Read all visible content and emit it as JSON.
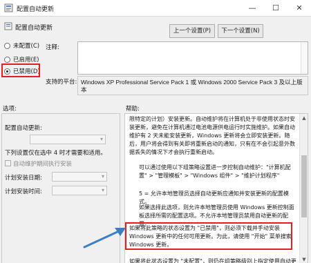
{
  "window": {
    "title": "配置自动更新",
    "buttons": [
      "—",
      "☐",
      "✕"
    ]
  },
  "header": {
    "policy_name": "配置自动更新",
    "prev_button": "上一个设置(P)",
    "next_button": "下一个设置(N)"
  },
  "state": {
    "options": [
      {
        "label": "未配置(C)",
        "checked": false
      },
      {
        "label": "已启用(E)",
        "checked": false
      },
      {
        "label": "已禁用(D)",
        "checked": true
      }
    ]
  },
  "comment": {
    "label": "注释:"
  },
  "platform": {
    "label": "支持的平台:",
    "value": "Windows XP Professional Service Pack 1 或 Windows 2000 Service Pack 3 及以上版本"
  },
  "sections": {
    "options": "选项:",
    "help": "帮助:"
  },
  "options_panel": {
    "configure_label": "配置自动更新:",
    "note": "下列设置仅在选中 4 时才需要和适用。",
    "maintenance_label": "自动维护期间执行安装",
    "schedule_day_label": "计划安装日期:",
    "schedule_time_label": "计划安装时间:"
  },
  "help": {
    "paragraphs": [
      "限特定的计划）安装更新。自动维护将在计算机处于非使用状态时安装更新，避免在计算机通过电池电源供电运行时实施维护。如果自动维护有 2 天未能安装更新，Windows 更新将会立即安装更新。随后，用户将会得到有关即将重新启动的通知，只有在不会引起意外数据丢失的情况下才会执行重新启动。",
      "可以通过使用以下组策略设置进一步控制自动维护：\"计算机配置\" > \"管理模板\" > \"Windows 组件\" > \"维护计划程序\"",
      "5 = 允许本地管理员选择自动更新应通知并安装更新的配置模式。",
      "如果选择此选项，则允许本地管理员使用 Windows 更新控制面板选择所需的配置选项。不允许本地管理员禁用自动更新的配置。",
      "如果将此策略的状态设置为 \"已禁用\"，则必须下载并手动安装 Windows 更新中的任何可用更新。为此，请使用 \"开始\" 菜单搜索 Windows 更新。",
      "如果将此状态设置为 \"未配置\"，则仍在组策略级别上指定使用自动更新。"
    ]
  },
  "colors": {
    "annotation": "#e02020",
    "arrow": "#3d7fc4"
  }
}
